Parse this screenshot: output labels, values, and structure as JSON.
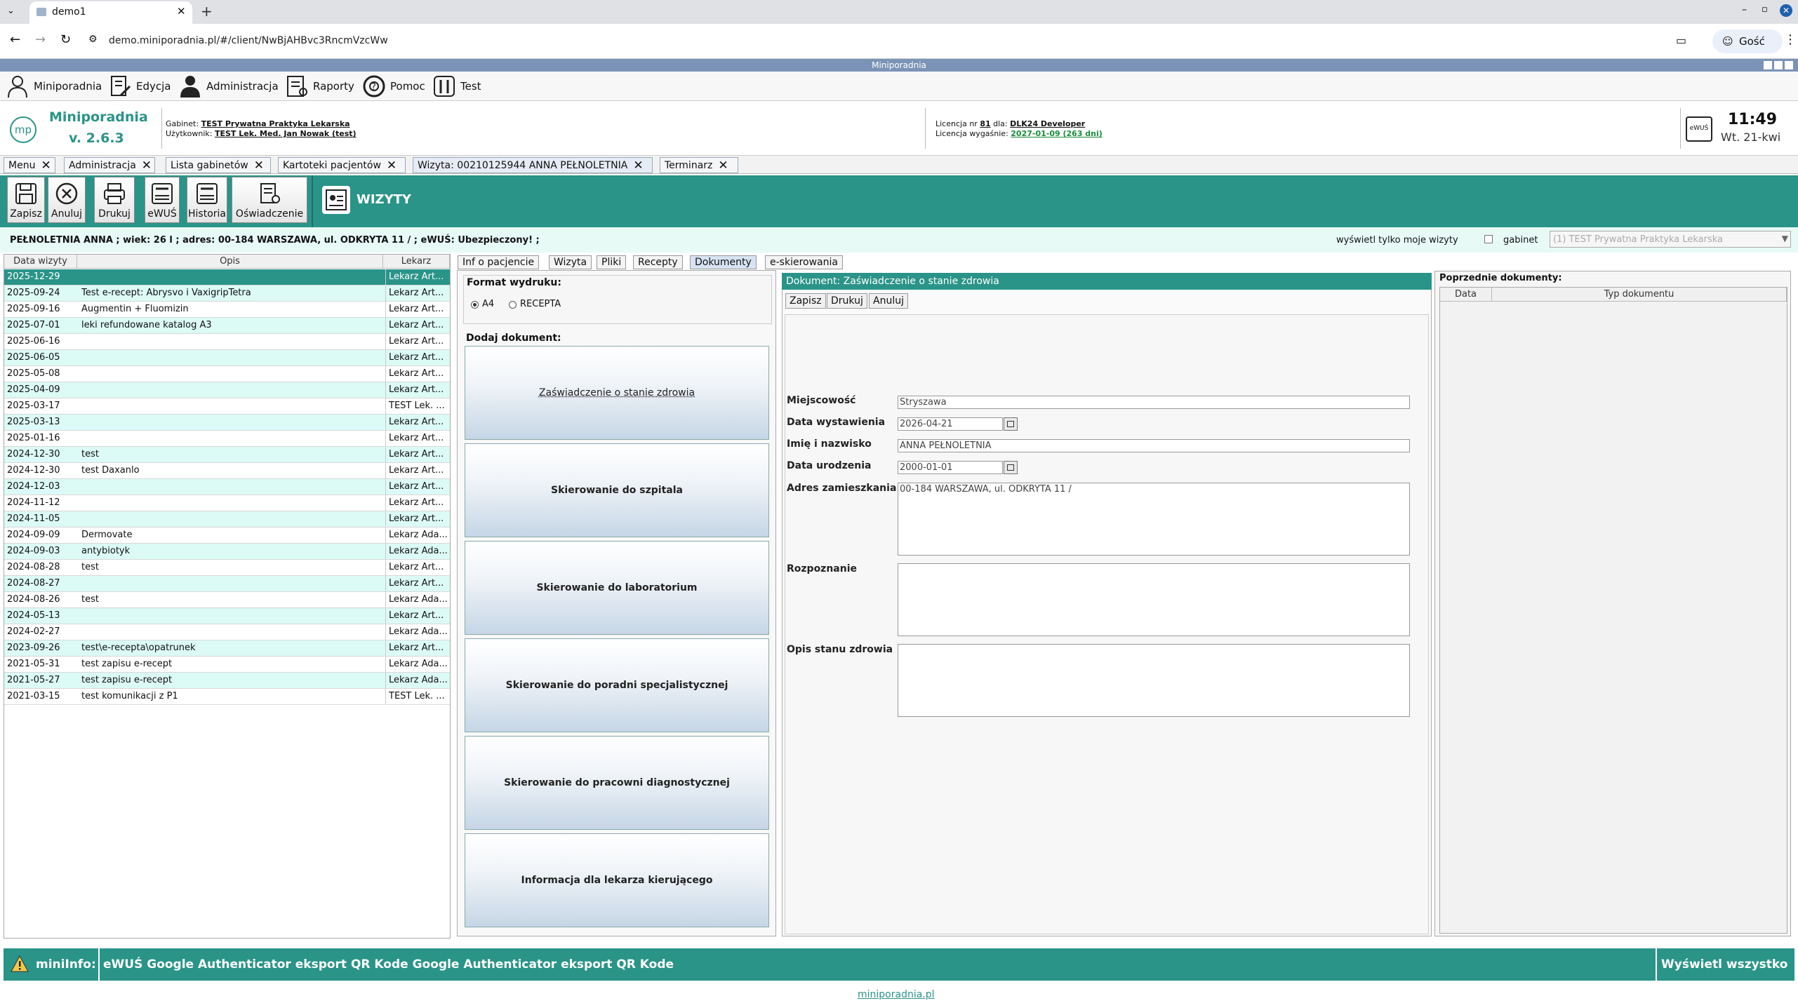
{
  "browser": {
    "tab_title": "demo1",
    "url": "demo.miniporadnia.pl/#/client/NwBjAHBvc3RncmVzcWw",
    "profile": "Gość"
  },
  "app_title": "Miniporadnia",
  "menu": [
    {
      "label": "Miniporadnia",
      "icon": "doctor-icon"
    },
    {
      "label": "Edycja",
      "icon": "edit-doc-icon"
    },
    {
      "label": "Administracja",
      "icon": "admin-icon"
    },
    {
      "label": "Raporty",
      "icon": "report-icon"
    },
    {
      "label": "Pomoc",
      "icon": "lifebuoy-icon"
    },
    {
      "label": "Test",
      "icon": "tools-icon"
    }
  ],
  "header": {
    "app_name": "Miniporadnia",
    "version": "v. 2.6.3",
    "logo_text": "mp",
    "gabinet_label": "Gabinet:",
    "gabinet_value": "TEST Prywatna Praktyka Lekarska",
    "user_label": "Użytkownik:",
    "user_value": "TEST Lek. Med. Jan Nowak (test)",
    "license_label": "Licencja nr",
    "license_nr": "81",
    "license_for": "dla:",
    "license_holder": "DLK24 Developer",
    "expiry_label": "Licencja wygaśnie:",
    "expiry_value": "2027-01-09 (263 dni)",
    "ewus_icon_label": "eWUŚ",
    "time": "11:49",
    "date": "Wt. 21-kwi"
  },
  "app_tabs": [
    {
      "label": "Menu"
    },
    {
      "label": "Administracja"
    },
    {
      "label": "Lista gabinetów"
    },
    {
      "label": "Kartoteki pacjentów"
    },
    {
      "label": "Wizyta: 00210125944 ANNA PEŁNOLETNIA"
    },
    {
      "label": "Terminarz"
    }
  ],
  "toolbar": {
    "buttons": [
      {
        "label": "Zapisz",
        "icon": "save-icon"
      },
      {
        "label": "Anuluj",
        "icon": "cancel-icon"
      },
      {
        "label": "Drukuj",
        "icon": "print-icon"
      },
      {
        "label": "eWUŚ",
        "icon": "ewus-icon"
      },
      {
        "label": "Historia",
        "icon": "history-icon"
      },
      {
        "label": "Oświadczenie",
        "icon": "statement-icon"
      }
    ],
    "section_title": "WIZYTY"
  },
  "patient_bar": {
    "info": "PEŁNOLETNIA ANNA ; wiek: 26 l ; adres: 00-184 WARSZAWA, ul. ODKRYTA 11 / ; eWUŚ: Ubezpieczony! ;",
    "only_mine_label": "wyświetl tylko moje wizyty",
    "gabinet_label": "gabinet",
    "gabinet_select": "(1) TEST Prywatna Praktyka Lekarska"
  },
  "visits_table": {
    "headers": [
      "Data wizyty",
      "Opis",
      "Lekarz"
    ],
    "rows": [
      [
        "2025-12-29",
        "",
        "Lekarz Art..."
      ],
      [
        "2025-09-24",
        "Test e-recept: Abrysvo i VaxigripTetra",
        "Lekarz Art..."
      ],
      [
        "2025-09-16",
        "Augmentin + Fluomizin",
        "Lekarz Art..."
      ],
      [
        "2025-07-01",
        "leki refundowane katalog A3",
        "Lekarz Art..."
      ],
      [
        "2025-06-16",
        "",
        "Lekarz Art..."
      ],
      [
        "2025-06-05",
        "",
        "Lekarz Art..."
      ],
      [
        "2025-05-08",
        "",
        "Lekarz Art..."
      ],
      [
        "2025-04-09",
        "",
        "Lekarz Art..."
      ],
      [
        "2025-03-17",
        "",
        "TEST Lek. ..."
      ],
      [
        "2025-03-13",
        "",
        "Lekarz Art..."
      ],
      [
        "2025-01-16",
        "",
        "Lekarz Art..."
      ],
      [
        "2024-12-30",
        "test",
        "Lekarz Art..."
      ],
      [
        "2024-12-30",
        "test Daxanlo",
        "Lekarz Art..."
      ],
      [
        "2024-12-03",
        "",
        "Lekarz Art..."
      ],
      [
        "2024-11-12",
        "",
        "Lekarz Art..."
      ],
      [
        "2024-11-05",
        "",
        "Lekarz Art..."
      ],
      [
        "2024-09-09",
        "Dermovate",
        "Lekarz Ada..."
      ],
      [
        "2024-09-03",
        "antybiotyk",
        "Lekarz Ada..."
      ],
      [
        "2024-08-28",
        "test",
        "Lekarz Art..."
      ],
      [
        "2024-08-27",
        "",
        "Lekarz Art..."
      ],
      [
        "2024-08-26",
        "test",
        "Lekarz Ada..."
      ],
      [
        "2024-05-13",
        "",
        "Lekarz Art..."
      ],
      [
        "2024-02-27",
        "",
        "Lekarz Ada..."
      ],
      [
        "2023-09-26",
        "test\\e-recepta\\opatrunek",
        "Lekarz Art..."
      ],
      [
        "2021-05-31",
        "test zapisu e-recept",
        "Lekarz Ada..."
      ],
      [
        "2021-05-27",
        "test zapisu e-recept",
        "Lekarz Ada..."
      ],
      [
        "2021-03-15",
        "test komunikacji z P1",
        "TEST Lek. ..."
      ]
    ]
  },
  "sub_tabs": [
    "Inf o pacjencie",
    "Wizyta",
    "Pliki",
    "Recepty",
    "Dokumenty",
    "e-skierowania"
  ],
  "print_format": {
    "label": "Format wydruku:",
    "options": [
      "A4",
      "RECEPTA"
    ]
  },
  "add_document": {
    "label": "Dodaj dokument:",
    "buttons": [
      "Zaświadczenie o stanie zdrowia",
      "Skierowanie do szpitala",
      "Skierowanie do laboratorium",
      "Skierowanie do poradni specjalistycznej",
      "Skierowanie do pracowni diagnostycznej",
      "Informacja dla lekarza kierującego"
    ]
  },
  "document_form": {
    "title": "Dokument: Zaświadczenie o stanie zdrowia",
    "buttons": [
      "Zapisz",
      "Drukuj",
      "Anuluj"
    ],
    "fields": {
      "miejscowosc_label": "Miejscowość",
      "miejscowosc_value": "Stryszawa",
      "data_wystawienia_label": "Data wystawienia",
      "data_wystawienia_value": "2026-04-21",
      "imie_label": "Imię i nazwisko",
      "imie_value": "ANNA PEŁNOLETNIA",
      "data_urodzenia_label": "Data urodzenia",
      "data_urodzenia_value": "2000-01-01",
      "adres_label": "Adres zamieszkania",
      "adres_value": "00-184 WARSZAWA, ul. ODKRYTA 11 /",
      "rozpoznanie_label": "Rozpoznanie",
      "opis_label": "Opis stanu zdrowia"
    }
  },
  "previous_docs": {
    "label": "Poprzednie dokumenty:",
    "headers": [
      "Data",
      "Typ dokumentu"
    ]
  },
  "footer": {
    "label": "miniInfo:",
    "message": "eWUŚ Google Authenticator eksport QR Kode Google Authenticator eksport QR Kode",
    "show_all": "Wyświetl wszystko",
    "link": "miniporadnia.pl"
  },
  "colors": {
    "teal": "#2a9488",
    "selected_row": "#2a9488",
    "alt_row": "#dcfaf6"
  }
}
